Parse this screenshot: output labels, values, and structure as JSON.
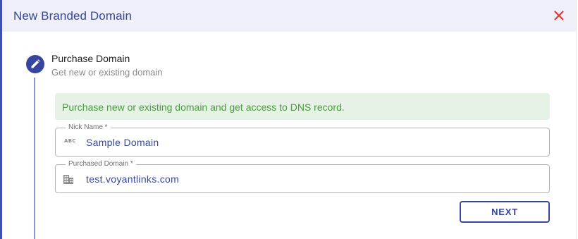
{
  "dialog": {
    "title": "New Branded Domain",
    "close_icon": "close-icon"
  },
  "step": {
    "icon": "pencil-icon",
    "title": "Purchase Domain",
    "subtitle": "Get new or existing domain"
  },
  "info": {
    "text": "Purchase new or existing domain and get access to DNS record."
  },
  "fields": {
    "nick_name": {
      "label": "Nick Name *",
      "icon": "abc-icon",
      "icon_text": "ABC",
      "value": "Sample Domain"
    },
    "purchased_domain": {
      "label": "Purchased Domain *",
      "icon": "building-icon",
      "value": "test.voyantlinks.com"
    }
  },
  "actions": {
    "next_label": "NEXT"
  },
  "colors": {
    "accent": "#3646a0",
    "close": "#e53935",
    "success_bg": "#e6f2e5",
    "success_text": "#4a9a3f",
    "header_bg": "#eeeff8"
  }
}
